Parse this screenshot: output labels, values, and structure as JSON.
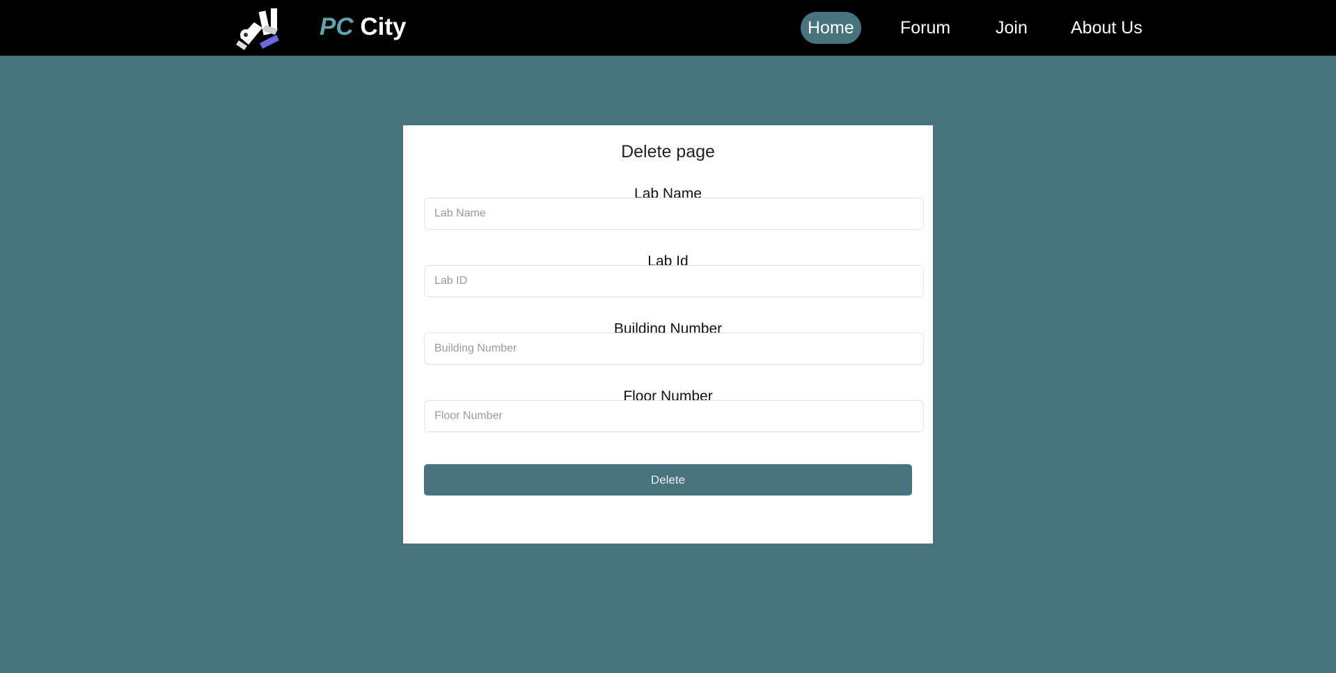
{
  "brand": {
    "logo_icon": "computer-parts-logo-icon",
    "name_part1": "PC",
    "name_part2": "City"
  },
  "nav": {
    "items": [
      {
        "label": "Home",
        "active": true
      },
      {
        "label": "Forum",
        "active": false
      },
      {
        "label": "Join",
        "active": false
      },
      {
        "label": "About Us",
        "active": false
      }
    ]
  },
  "form": {
    "title": "Delete page",
    "fields": [
      {
        "label": "Lab Name",
        "placeholder": "Lab Name",
        "value": ""
      },
      {
        "label": "Lab Id",
        "placeholder": "Lab ID",
        "value": ""
      },
      {
        "label": "Building Number",
        "placeholder": "Building Number",
        "value": ""
      },
      {
        "label": "Floor Number",
        "placeholder": "Floor Number",
        "value": ""
      }
    ],
    "submit_label": "Delete"
  },
  "colors": {
    "navbar_bg": "#000000",
    "page_bg": "#47737e",
    "accent": "#47737e",
    "brand_pc": "#5fa3b0",
    "card_bg": "#ffffff"
  }
}
